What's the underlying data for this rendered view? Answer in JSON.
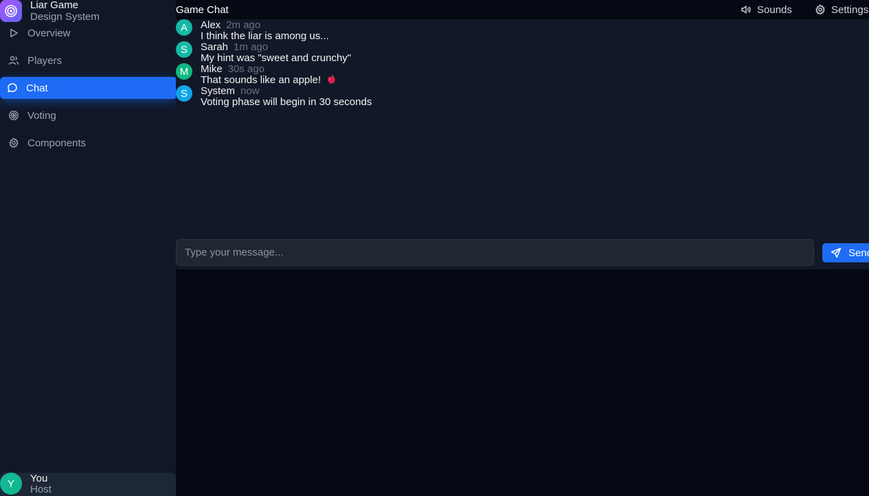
{
  "brand": {
    "title": "Liar Game",
    "subtitle": "Design System",
    "logo_icon": "target-icon"
  },
  "nav": {
    "items": [
      {
        "label": "Overview",
        "icon": "play-icon",
        "active": false
      },
      {
        "label": "Players",
        "icon": "users-icon",
        "active": false
      },
      {
        "label": "Chat",
        "icon": "message-circle-icon",
        "active": true
      },
      {
        "label": "Voting",
        "icon": "target-icon",
        "active": false
      },
      {
        "label": "Components",
        "icon": "gear-icon",
        "active": false
      }
    ]
  },
  "user": {
    "initial": "Y",
    "name": "You",
    "role": "Host"
  },
  "topbar": {
    "title": "Game Chat",
    "sounds_label": "Sounds",
    "settings_label": "Settings"
  },
  "messages": [
    {
      "initial": "A",
      "author": "Alex",
      "time": "2m ago",
      "text": "I think the liar is among us...",
      "color": "#14b8a6"
    },
    {
      "initial": "S",
      "author": "Sarah",
      "time": "1m ago",
      "text": "My hint was \"sweet and crunchy\"",
      "color": "#14b8a6"
    },
    {
      "initial": "M",
      "author": "Mike",
      "time": "30s ago",
      "text": "That sounds like an apple!",
      "color": "#10b981",
      "emoji": "apple-icon"
    },
    {
      "initial": "S",
      "author": "System",
      "time": "now",
      "text": "Voting phase will begin in 30 seconds",
      "color": "#0ea5e9"
    }
  ],
  "composer": {
    "placeholder": "Type your message...",
    "value": "",
    "send_label": "Send"
  },
  "colors": {
    "accent": "#1e6cf5",
    "sidebar_bg": "#101828",
    "panel_bg": "#111827",
    "page_bg": "#050914"
  }
}
